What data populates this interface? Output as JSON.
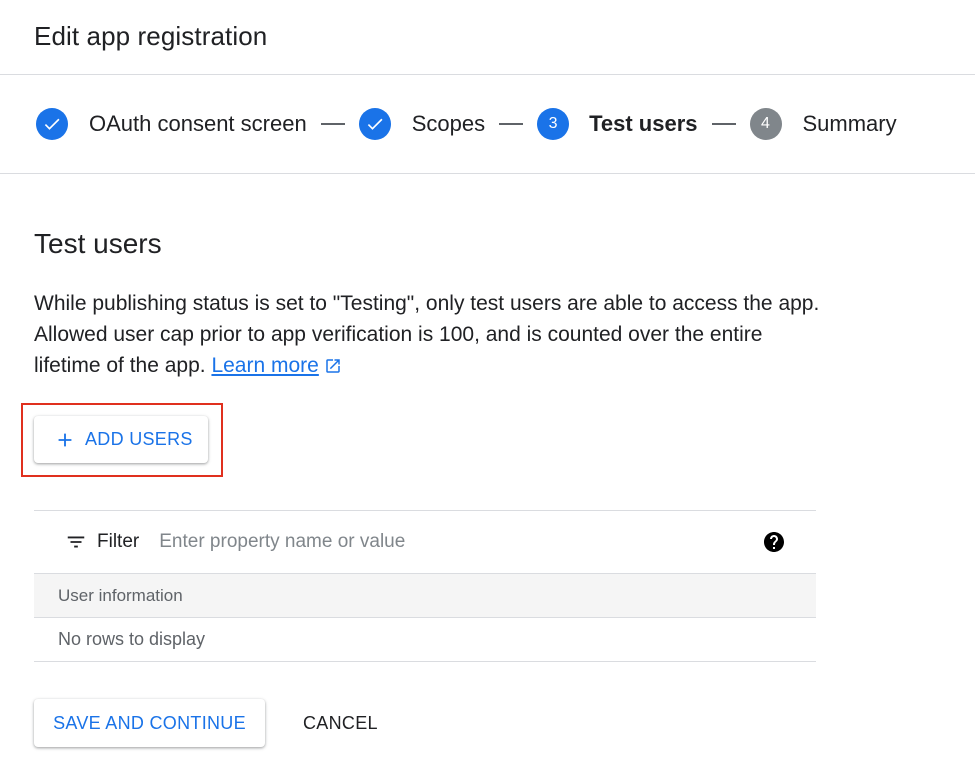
{
  "header": {
    "title": "Edit app registration"
  },
  "stepper": {
    "steps": [
      {
        "label": "OAuth consent screen",
        "state": "done",
        "icon": "check-icon"
      },
      {
        "label": "Scopes",
        "state": "done",
        "icon": "check-icon"
      },
      {
        "label": "Test users",
        "state": "active",
        "number": "3"
      },
      {
        "label": "Summary",
        "state": "todo",
        "number": "4"
      }
    ]
  },
  "section": {
    "title": "Test users",
    "description": "While publishing status is set to \"Testing\", only test users are able to access the app. Allowed user cap prior to app verification is 100, and is counted over the entire lifetime of the app.",
    "learn_more": "Learn more"
  },
  "add_users": {
    "label": "ADD USERS",
    "icon": "plus-icon"
  },
  "filter": {
    "label": "Filter",
    "placeholder": "Enter property name or value",
    "icon": "filter-icon",
    "help_icon": "help-icon"
  },
  "table": {
    "columns": [
      "User information"
    ],
    "empty_text": "No rows to display"
  },
  "actions": {
    "save_label": "SAVE AND CONTINUE",
    "cancel_label": "CANCEL"
  },
  "colors": {
    "accent": "#1a73e8",
    "highlight_border": "#e0301e",
    "inactive_step": "#80868b"
  }
}
